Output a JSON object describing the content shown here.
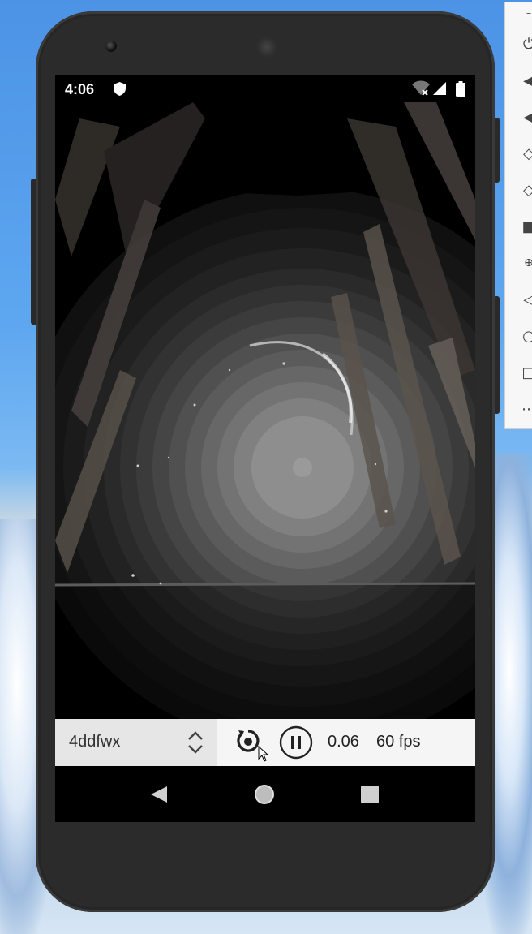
{
  "status_bar": {
    "time": "4:06"
  },
  "controls": {
    "preset_value": "4ddfwx",
    "time_value": "0.06",
    "fps_value": "60 fps"
  },
  "side_toolbar": {
    "items": [
      "minimize-icon",
      "power-icon",
      "volume-up-icon",
      "volume-down-icon",
      "rotate-left-icon",
      "rotate-right-icon",
      "camera-icon",
      "zoom-icon",
      "back-icon",
      "home-icon",
      "overview-icon",
      "more-icon"
    ]
  },
  "colors": {
    "phone_body": "#2b2b2b",
    "control_bar": "#f5f5f5",
    "preset_box": "#e6e6e6"
  }
}
